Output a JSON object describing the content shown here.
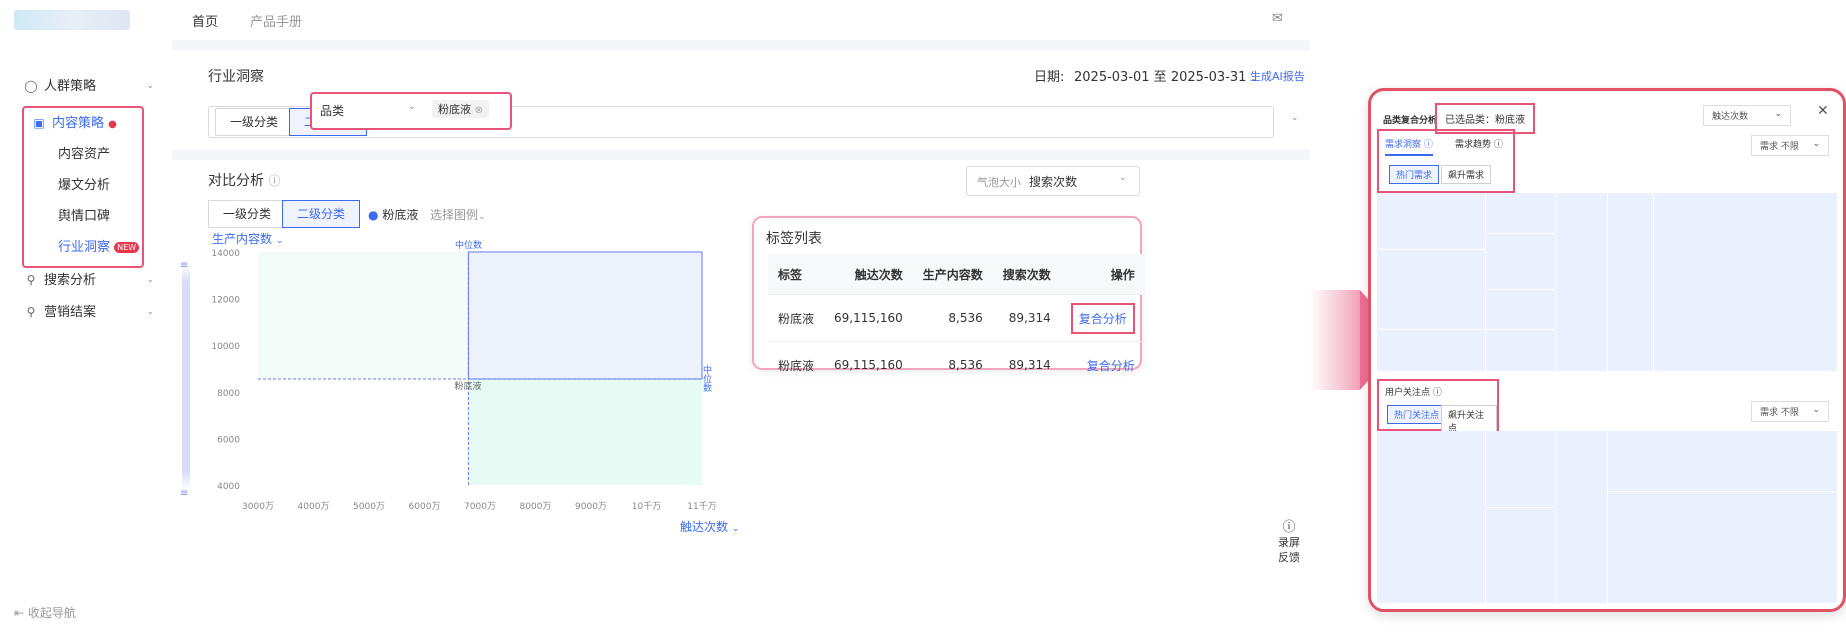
{
  "top_nav": {
    "home": "首页",
    "manual": "产品手册",
    "message_icon": "message-icon"
  },
  "sidebar": {
    "items": [
      {
        "label": "人群策略",
        "icon": "users-icon"
      },
      {
        "label": "内容策略",
        "icon": "content-icon"
      },
      {
        "label": "内容资产"
      },
      {
        "label": "爆文分析"
      },
      {
        "label": "舆情口碑"
      },
      {
        "label": "行业洞察",
        "badge": "NEW"
      },
      {
        "label": "搜索分析",
        "icon": "search-icon"
      },
      {
        "label": "营销结案",
        "icon": "report-icon"
      }
    ],
    "collapse_label": "收起导航"
  },
  "header": {
    "title": "行业洞察",
    "date_label": "日期:",
    "date_range": "2025-03-01 至 2025-03-31",
    "ai_report": "生成AI报告"
  },
  "filter": {
    "tabs": [
      "一级分类",
      "二级分类"
    ],
    "category_placeholder": "品类",
    "selected_tag": "粉底液"
  },
  "compare": {
    "title": "对比分析",
    "tabs": [
      "一级分类",
      "二级分类"
    ],
    "legend_item": "粉底液",
    "legend_select": "选择图例",
    "bubble_label": "气泡大小",
    "bubble_value": "搜索次数"
  },
  "chart_data": {
    "type": "scatter",
    "ylabel": "生产内容数",
    "xlabel": "触达次数",
    "yticks": [
      "14000",
      "12000",
      "10000",
      "8000",
      "6000",
      "4000"
    ],
    "xticks": [
      "3000万",
      "4000万",
      "5000万",
      "6000万",
      "7000万",
      "8000万",
      "9000万",
      "10千万",
      "11千万"
    ],
    "median_x_label": "中位数",
    "median_y_label": "中位数",
    "points": [
      {
        "label": "粉底液"
      }
    ]
  },
  "tag_list": {
    "title": "标签列表",
    "columns": [
      "标签",
      "触达次数",
      "生产内容数",
      "搜索次数",
      "操作"
    ],
    "rows": [
      {
        "tag": "粉底液",
        "reach": "69,115,160",
        "content": "8,536",
        "search": "89,314",
        "action": "复合分析"
      },
      {
        "tag": "粉底液",
        "reach": "69,115,160",
        "content": "8,536",
        "search": "89,314",
        "action": "复合分析"
      }
    ]
  },
  "feedback": {
    "label1": "录屏",
    "label2": "反馈"
  },
  "right_panel": {
    "title": "品类复合分析",
    "selected": "已选品类：粉底液",
    "select_value": "触达次数",
    "tabs": [
      "需求洞察",
      "需求趋势"
    ],
    "subtabs": [
      "热门需求",
      "飙升需求"
    ],
    "filter": "需求 不限",
    "section2_title": "用户关注点",
    "section2_subtabs": [
      "热门关注点",
      "飙升关注点"
    ],
    "section2_filter": "需求 不限"
  },
  "colors": {
    "accent": "#3d6bf0",
    "highlight": "#e8537a",
    "panel_border": "#e05264"
  }
}
